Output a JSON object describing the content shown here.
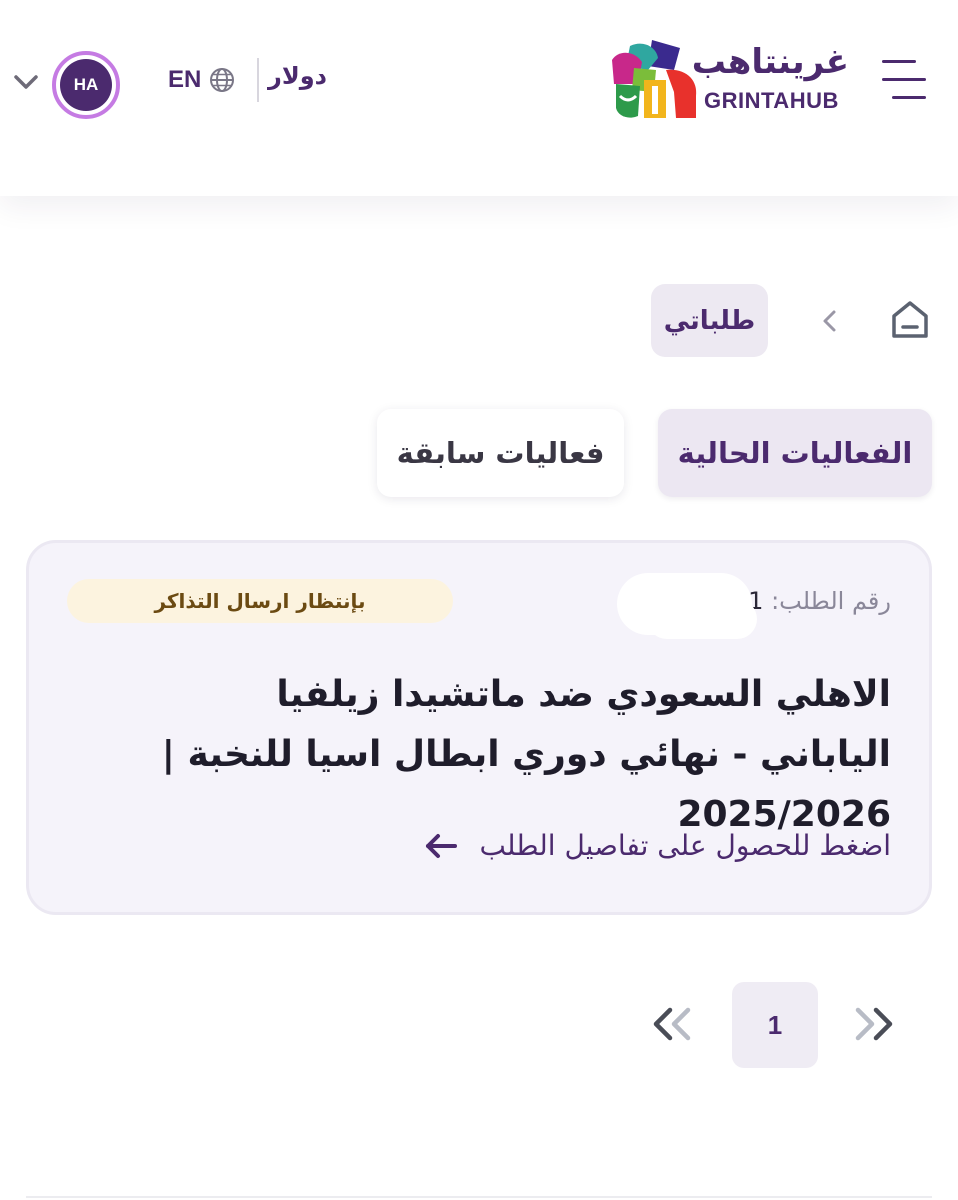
{
  "header": {
    "brand_ar": "غرينتاهب",
    "brand_en": "GRINTAHUB",
    "currency_label": "دولار",
    "language_label": "EN",
    "avatar_initials": "HA",
    "icons": [
      "menu-icon",
      "globe-icon",
      "chevron-down-icon"
    ]
  },
  "breadcrumb": {
    "current": "طلباتي",
    "icons": [
      "home-icon",
      "chevron-right-icon"
    ]
  },
  "tabs": [
    {
      "label": "الفعاليات الحالية",
      "active": true
    },
    {
      "label": "فعاليات سابقة",
      "active": false
    }
  ],
  "order": {
    "number_label": "رقم الطلب:",
    "number_visible": "1",
    "status": "بإنتظار ارسال التذاكر",
    "title": "الاهلي السعودي ضد ماتشيدا زيلفيا الياباني - نهائي دوري ابطال اسيا للنخبة | 2025/2026",
    "details_link": "اضغط للحصول على تفاصيل الطلب"
  },
  "pagination": {
    "current_page": "1"
  },
  "colors": {
    "brand_purple": "#4b2a6e",
    "avatar_ring": "#c57be3",
    "status_bg": "#fcf3df",
    "status_text": "#6b4a12",
    "card_bg": "#f5f3fa"
  }
}
